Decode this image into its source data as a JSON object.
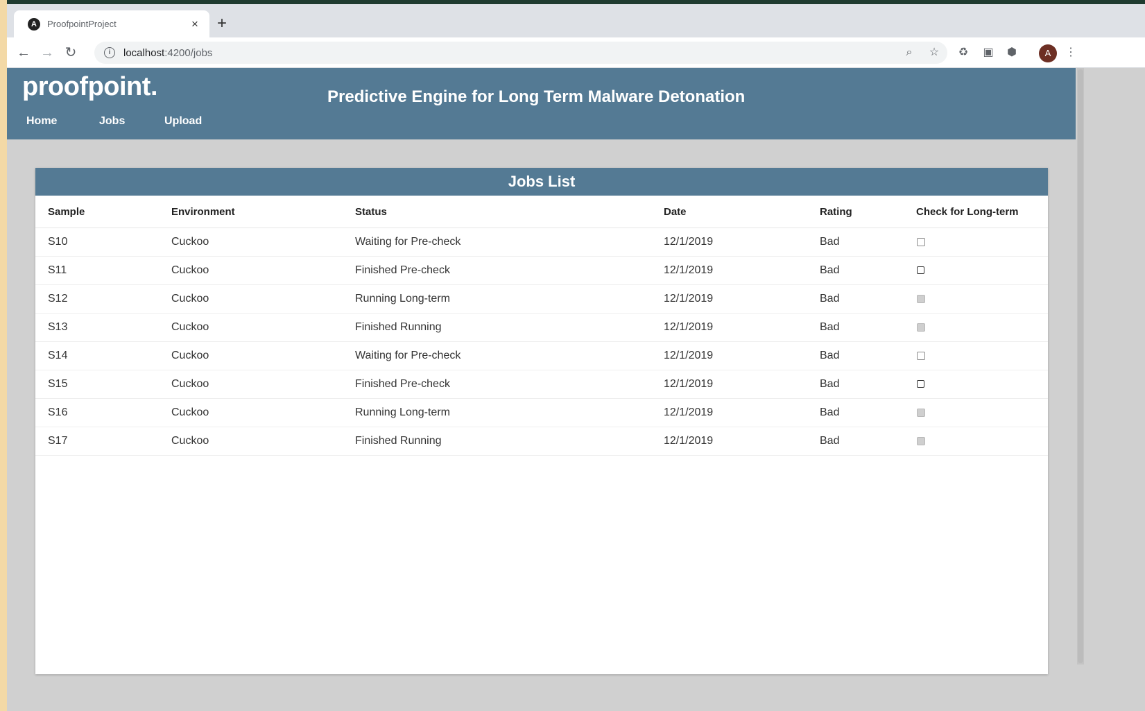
{
  "browser": {
    "tab_title": "ProofpointProject",
    "tab_close": "×",
    "new_tab": "+",
    "url_host": "localhost",
    "url_path": ":4200/jobs",
    "avatar_letter": "A"
  },
  "header": {
    "logo": "proofpoint",
    "logo_dot": ".",
    "title": "Predictive Engine for Long Term Malware Detonation",
    "nav": {
      "home": "Home",
      "jobs": "Jobs",
      "upload": "Upload"
    }
  },
  "jobs": {
    "heading": "Jobs List",
    "columns": {
      "sample": "Sample",
      "environment": "Environment",
      "status": "Status",
      "date": "Date",
      "rating": "Rating",
      "check": "Check for Long-term"
    },
    "rows": [
      {
        "sample": "S10",
        "environment": "Cuckoo",
        "status": "Waiting for Pre-check",
        "date": "12/1/2019",
        "rating": "Bad",
        "checkbox_state": "unchecked"
      },
      {
        "sample": "S11",
        "environment": "Cuckoo",
        "status": "Finished Pre-check",
        "date": "12/1/2019",
        "rating": "Bad",
        "checkbox_state": "enabled"
      },
      {
        "sample": "S12",
        "environment": "Cuckoo",
        "status": "Running Long-term",
        "date": "12/1/2019",
        "rating": "Bad",
        "checkbox_state": "disabled"
      },
      {
        "sample": "S13",
        "environment": "Cuckoo",
        "status": "Finished Running",
        "date": "12/1/2019",
        "rating": "Bad",
        "checkbox_state": "disabled"
      },
      {
        "sample": "S14",
        "environment": "Cuckoo",
        "status": "Waiting for Pre-check",
        "date": "12/1/2019",
        "rating": "Bad",
        "checkbox_state": "unchecked"
      },
      {
        "sample": "S15",
        "environment": "Cuckoo",
        "status": "Finished Pre-check",
        "date": "12/1/2019",
        "rating": "Bad",
        "checkbox_state": "enabled"
      },
      {
        "sample": "S16",
        "environment": "Cuckoo",
        "status": "Running Long-term",
        "date": "12/1/2019",
        "rating": "Bad",
        "checkbox_state": "disabled"
      },
      {
        "sample": "S17",
        "environment": "Cuckoo",
        "status": "Finished Running",
        "date": "12/1/2019",
        "rating": "Bad",
        "checkbox_state": "disabled"
      }
    ]
  },
  "colors": {
    "header_bg": "#547a94",
    "page_bg": "#d0d0d0",
    "card_bg": "#ffffff"
  }
}
